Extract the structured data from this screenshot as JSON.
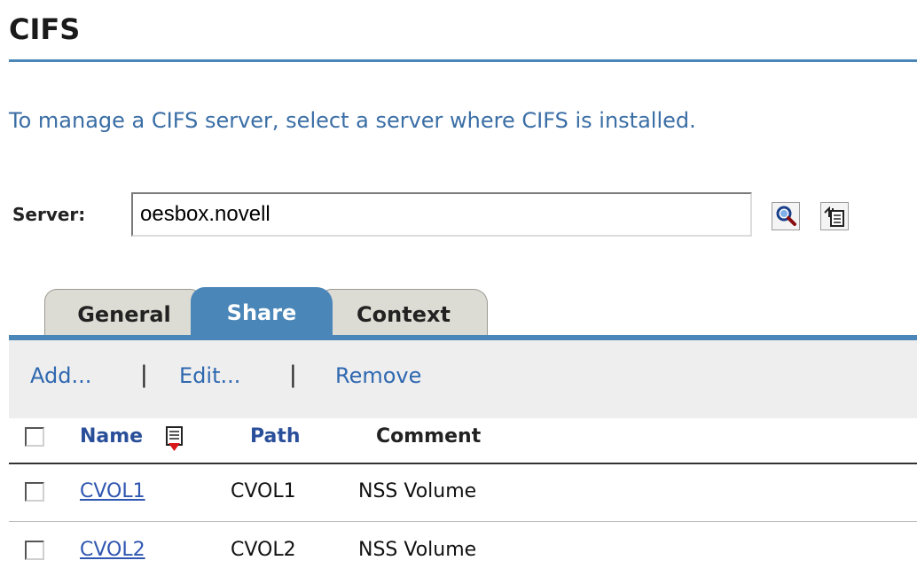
{
  "page": {
    "title": "CIFS",
    "intro": "To manage a CIFS server, select a server where CIFS is installed."
  },
  "server": {
    "label": "Server:",
    "value": "oesbox.novell",
    "search_icon": "search-icon",
    "browse_icon": "object-browser-icon"
  },
  "tabs": [
    {
      "label": "General",
      "active": false
    },
    {
      "label": "Share",
      "active": true
    },
    {
      "label": "Context",
      "active": false
    }
  ],
  "toolbar": {
    "add": "Add...",
    "edit": "Edit...",
    "remove": "Remove",
    "separator": "|"
  },
  "table": {
    "columns": [
      "Name",
      "Path",
      "Comment"
    ],
    "sort_icon": "sort-descending-icon",
    "rows": [
      {
        "name": "CVOL1",
        "path": "CVOL1",
        "comment": "NSS Volume",
        "checked": false
      },
      {
        "name": "CVOL2",
        "path": "CVOL2",
        "comment": "NSS Volume",
        "checked": false
      }
    ]
  },
  "colors": {
    "accent": "#4a86b8",
    "link": "#2f68b0",
    "tab_inactive": "#dcdcd4"
  }
}
